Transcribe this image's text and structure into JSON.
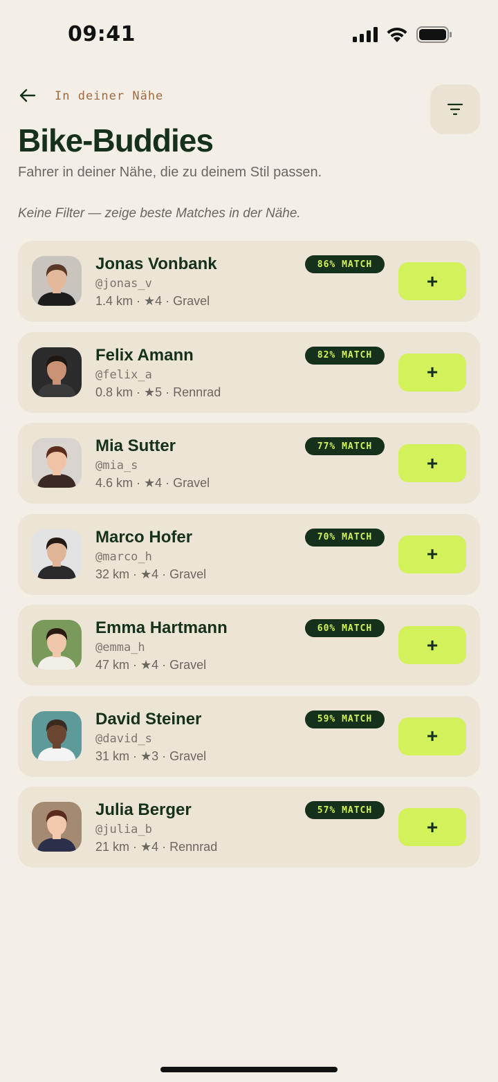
{
  "status_bar": {
    "time": "09:41"
  },
  "header": {
    "breadcrumb": "In deiner Nähe",
    "title": "Bike-Buddies",
    "subtitle": "Fahrer in deiner Nähe, die zu deinem Stil passen.",
    "filter_note": "Keine Filter — zeige beste Matches in der Nähe."
  },
  "colors": {
    "background": "#f3efe7",
    "card": "#ece4d4",
    "accent": "#d3f15a",
    "dark_green": "#15301b",
    "breadcrumb": "#a0693e"
  },
  "riders": [
    {
      "name": "Jonas Vonbank",
      "handle": "@jonas_v",
      "meta": "1.4 km · ★4 · Gravel",
      "match": "86% MATCH",
      "add_label": "+",
      "avatar": {
        "bg": "#c9c4bd",
        "skin": "#e4b89a",
        "hair": "#5a3a26",
        "shirt": "#1d1d1d"
      }
    },
    {
      "name": "Felix Amann",
      "handle": "@felix_a",
      "meta": "0.8 km · ★5 · Rennrad",
      "match": "82% MATCH",
      "add_label": "+",
      "avatar": {
        "bg": "#2b2b2b",
        "skin": "#c99275",
        "hair": "#1e1713",
        "shirt": "#3a3a3a"
      }
    },
    {
      "name": "Mia Sutter",
      "handle": "@mia_s",
      "meta": "4.6 km · ★4 · Gravel",
      "match": "77% MATCH",
      "add_label": "+",
      "avatar": {
        "bg": "#d9d4cf",
        "skin": "#f0c3a6",
        "hair": "#5c2c1c",
        "shirt": "#3b2a24"
      }
    },
    {
      "name": "Marco Hofer",
      "handle": "@marco_h",
      "meta": "32 km · ★4 · Gravel",
      "match": "70% MATCH",
      "add_label": "+",
      "avatar": {
        "bg": "#e3e3e3",
        "skin": "#e0b497",
        "hair": "#241a14",
        "shirt": "#2a2a2a"
      }
    },
    {
      "name": "Emma Hartmann",
      "handle": "@emma_h",
      "meta": "47 km · ★4 · Gravel",
      "match": "60% MATCH",
      "add_label": "+",
      "avatar": {
        "bg": "#7a9a5c",
        "skin": "#efc8ac",
        "hair": "#2b1a10",
        "shirt": "#f2efe9"
      }
    },
    {
      "name": "David Steiner",
      "handle": "@david_s",
      "meta": "31 km · ★3 · Gravel",
      "match": "59% MATCH",
      "add_label": "+",
      "avatar": {
        "bg": "#5e9a9a",
        "skin": "#6b4530",
        "hair": "#3a2a20",
        "shirt": "#f4f4f4"
      }
    },
    {
      "name": "Julia Berger",
      "handle": "@julia_b",
      "meta": "21 km · ★4 · Rennrad",
      "match": "57% MATCH",
      "add_label": "+",
      "avatar": {
        "bg": "#a48a70",
        "skin": "#f2c9ad",
        "hair": "#5a2a1e",
        "shirt": "#2b2f4a"
      }
    }
  ]
}
